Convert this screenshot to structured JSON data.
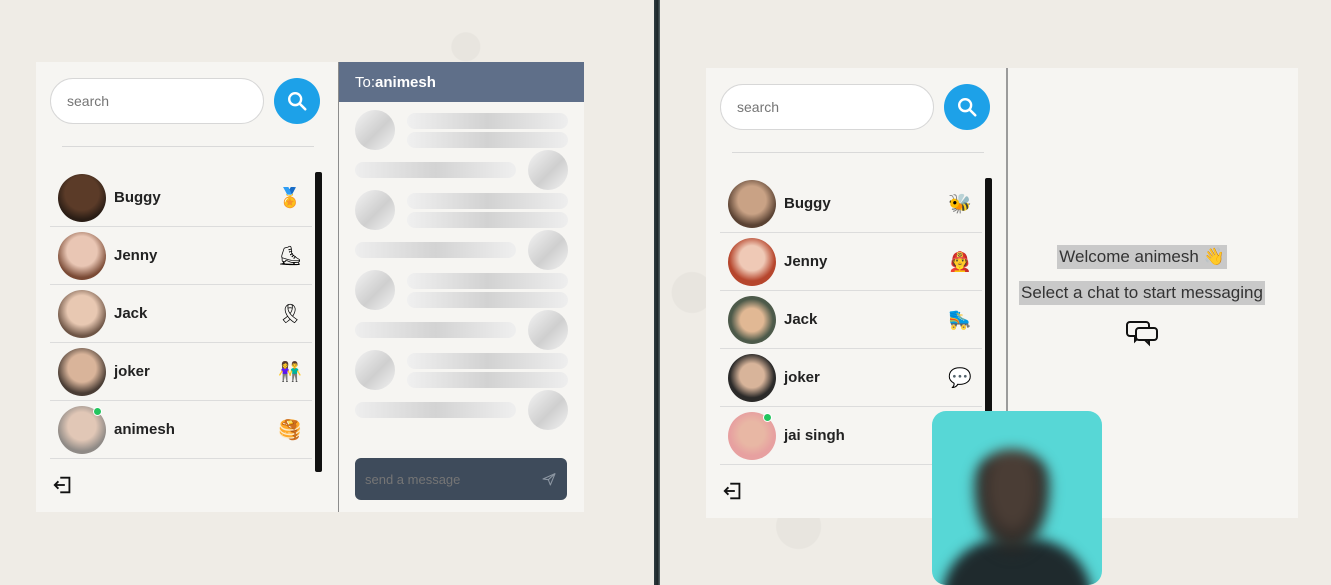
{
  "left_app": {
    "search": {
      "placeholder": "search"
    },
    "chat_header": {
      "prefix": "To:",
      "recipient": "animesh"
    },
    "composer": {
      "placeholder": "send a message"
    },
    "contacts": [
      {
        "name": "Buggy",
        "emoji": "🏅",
        "avatar_color": "#3a2a20",
        "online": false
      },
      {
        "name": "Jenny",
        "emoji": "⛸",
        "avatar_color": "#b58a78",
        "online": false
      },
      {
        "name": "Jack",
        "emoji": "🎗",
        "avatar_color": "#8e7a6c",
        "online": false
      },
      {
        "name": "joker",
        "emoji": "👫",
        "avatar_color": "#4d4440",
        "online": false
      },
      {
        "name": "animesh",
        "emoji": "🥞",
        "avatar_color": "#9c948f",
        "online": true
      }
    ]
  },
  "right_app": {
    "search": {
      "placeholder": "search"
    },
    "welcome": {
      "line1": "Welcome animesh 👋",
      "line2": "Select a chat to start messaging"
    },
    "contacts": [
      {
        "name": "Buggy",
        "emoji": "🐝",
        "avatar_color": "#6b5041",
        "online": false
      },
      {
        "name": "Jenny",
        "emoji": "🧑‍🚒",
        "avatar_color": "#b6462d",
        "online": false
      },
      {
        "name": "Jack",
        "emoji": "🛼",
        "avatar_color": "#6d5a4b",
        "online": false
      },
      {
        "name": "joker",
        "emoji": "💬",
        "avatar_color": "#3a3734",
        "online": false
      },
      {
        "name": "jai singh",
        "emoji": "",
        "avatar_color": "#e7a0a0",
        "online": true
      }
    ]
  },
  "colors": {
    "accent": "#1da1e8",
    "chat_header_bg": "#5f6f89",
    "composer_bg": "#3e4b5b",
    "online": "#22c55e"
  },
  "icons": {
    "search": "search-icon",
    "logout": "logout-icon",
    "send": "send-icon",
    "chat": "chat-bubbles-icon"
  }
}
